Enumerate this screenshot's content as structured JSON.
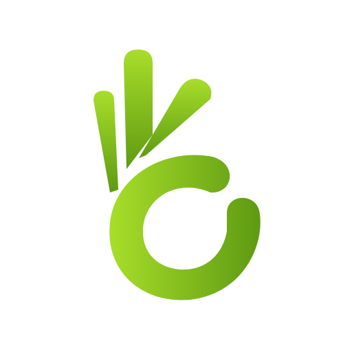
{
  "icon": {
    "name": "ok-hand-gesture-icon",
    "colors": {
      "light_green": "#a8de2a",
      "mid_green": "#7fba1f",
      "dark_green": "#5e9a12",
      "background": "#ffffff"
    }
  }
}
